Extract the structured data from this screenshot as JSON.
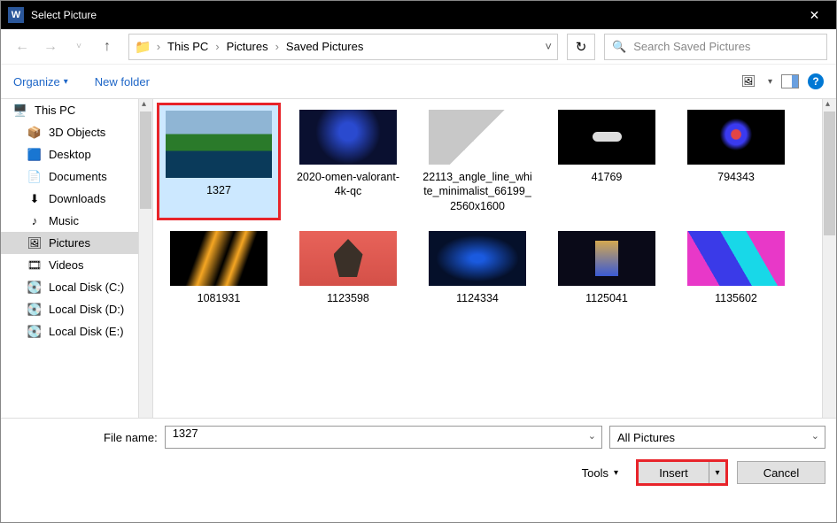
{
  "titlebar": {
    "title": "Select Picture"
  },
  "breadcrumb": {
    "items": [
      "This PC",
      "Pictures",
      "Saved Pictures"
    ]
  },
  "search": {
    "placeholder": "Search Saved Pictures"
  },
  "toolbar": {
    "organize": "Organize",
    "new_folder": "New folder"
  },
  "sidebar": {
    "items": [
      {
        "label": "This PC",
        "icon": "🖥️",
        "lvl": 0
      },
      {
        "label": "3D Objects",
        "icon": "📦"
      },
      {
        "label": "Desktop",
        "icon": "🟦"
      },
      {
        "label": "Documents",
        "icon": "📄"
      },
      {
        "label": "Downloads",
        "icon": "⬇"
      },
      {
        "label": "Music",
        "icon": "♪"
      },
      {
        "label": "Pictures",
        "icon": "🖼",
        "selected": true
      },
      {
        "label": "Videos",
        "icon": "🎞"
      },
      {
        "label": "Local Disk (C:)",
        "icon": "💽"
      },
      {
        "label": "Local Disk (D:)",
        "icon": "💽"
      },
      {
        "label": "Local Disk (E:)",
        "icon": "💽"
      }
    ]
  },
  "files": [
    {
      "name": "1327",
      "thumb": "th-1327",
      "selected": true
    },
    {
      "name": "2020-omen-valorant-4k-qc",
      "thumb": "th-omen"
    },
    {
      "name": "22113_angle_line_white_minimalist_66199_2560x1600",
      "thumb": "th-angle"
    },
    {
      "name": "41769",
      "thumb": "th-41769"
    },
    {
      "name": "794343",
      "thumb": "th-794343"
    },
    {
      "name": "1081931",
      "thumb": "th-1081931"
    },
    {
      "name": "1123598",
      "thumb": "th-1123598"
    },
    {
      "name": "1124334",
      "thumb": "th-1124334"
    },
    {
      "name": "1125041",
      "thumb": "th-1125041"
    },
    {
      "name": "1135602",
      "thumb": "th-1135602"
    }
  ],
  "footer": {
    "file_name_label": "File name:",
    "file_name_value": "1327",
    "filter": "All Pictures",
    "tools": "Tools",
    "insert": "Insert",
    "cancel": "Cancel"
  }
}
